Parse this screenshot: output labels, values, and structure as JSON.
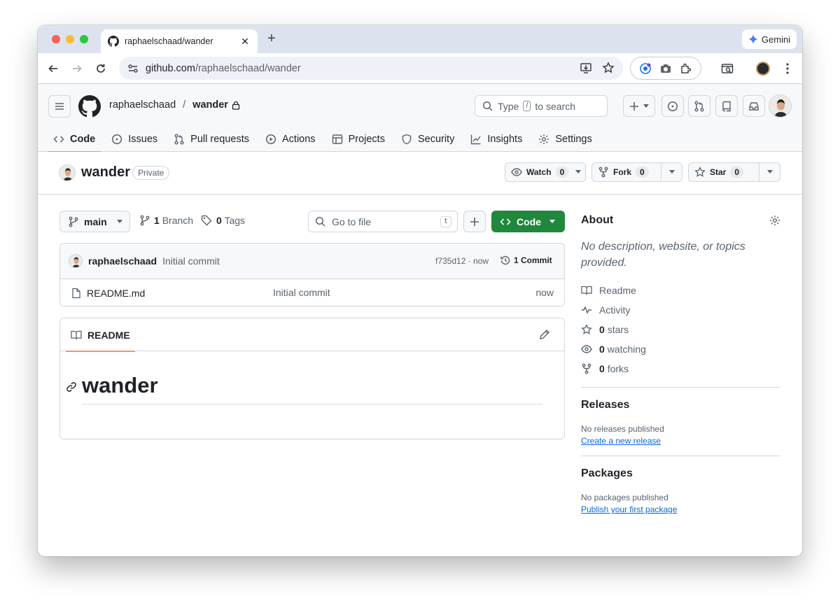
{
  "browser": {
    "tab_title": "raphaelschaad/wander",
    "tab_close": "✕",
    "new_tab": "+",
    "gemini_label": "Gemini",
    "url_host": "github.com",
    "url_path": "/raphaelschaad/wander"
  },
  "header": {
    "owner": "raphaelschaad",
    "separator": "/",
    "repo": "wander",
    "search_prefix": "Type",
    "search_key": "/",
    "search_suffix": "to search"
  },
  "repo_nav": [
    {
      "label": "Code",
      "icon": "code-icon",
      "active": true
    },
    {
      "label": "Issues",
      "icon": "issue-icon"
    },
    {
      "label": "Pull requests",
      "icon": "pull-request-icon"
    },
    {
      "label": "Actions",
      "icon": "play-icon"
    },
    {
      "label": "Projects",
      "icon": "table-icon"
    },
    {
      "label": "Security",
      "icon": "shield-icon"
    },
    {
      "label": "Insights",
      "icon": "graph-icon"
    },
    {
      "label": "Settings",
      "icon": "gear-icon"
    }
  ],
  "repo": {
    "name": "wander",
    "visibility": "Private",
    "watch_label": "Watch",
    "watch_count": "0",
    "fork_label": "Fork",
    "fork_count": "0",
    "star_label": "Star",
    "star_count": "0"
  },
  "toolbar": {
    "branch": "main",
    "branch_count": "1",
    "branch_label": "Branch",
    "tag_count": "0",
    "tag_label": "Tags",
    "goto_placeholder": "Go to file",
    "goto_key": "t",
    "code_label": "Code"
  },
  "commit": {
    "author": "raphaelschaad",
    "message": "Initial commit",
    "sha_time": "f735d12 · now",
    "count_label": "1 Commit"
  },
  "files": [
    {
      "name": "README.md",
      "message": "Initial commit",
      "time": "now"
    }
  ],
  "readme": {
    "tab_label": "README",
    "heading": "wander"
  },
  "sidebar": {
    "about_title": "About",
    "about_desc": "No description, website, or topics provided.",
    "links": [
      {
        "icon": "book-icon",
        "count": "",
        "label": "Readme"
      },
      {
        "icon": "pulse-icon",
        "count": "",
        "label": "Activity"
      },
      {
        "icon": "star-icon",
        "count": "0",
        "label": "stars"
      },
      {
        "icon": "eye-icon",
        "count": "0",
        "label": "watching"
      },
      {
        "icon": "fork-icon",
        "count": "0",
        "label": "forks"
      }
    ],
    "releases_title": "Releases",
    "releases_note": "No releases published",
    "releases_link": "Create a new release",
    "packages_title": "Packages",
    "packages_note": "No packages published",
    "packages_link": "Publish your first package"
  },
  "colors": {
    "accent_green": "#1f883d",
    "underline": "#fd8c73",
    "link": "#0969da"
  }
}
